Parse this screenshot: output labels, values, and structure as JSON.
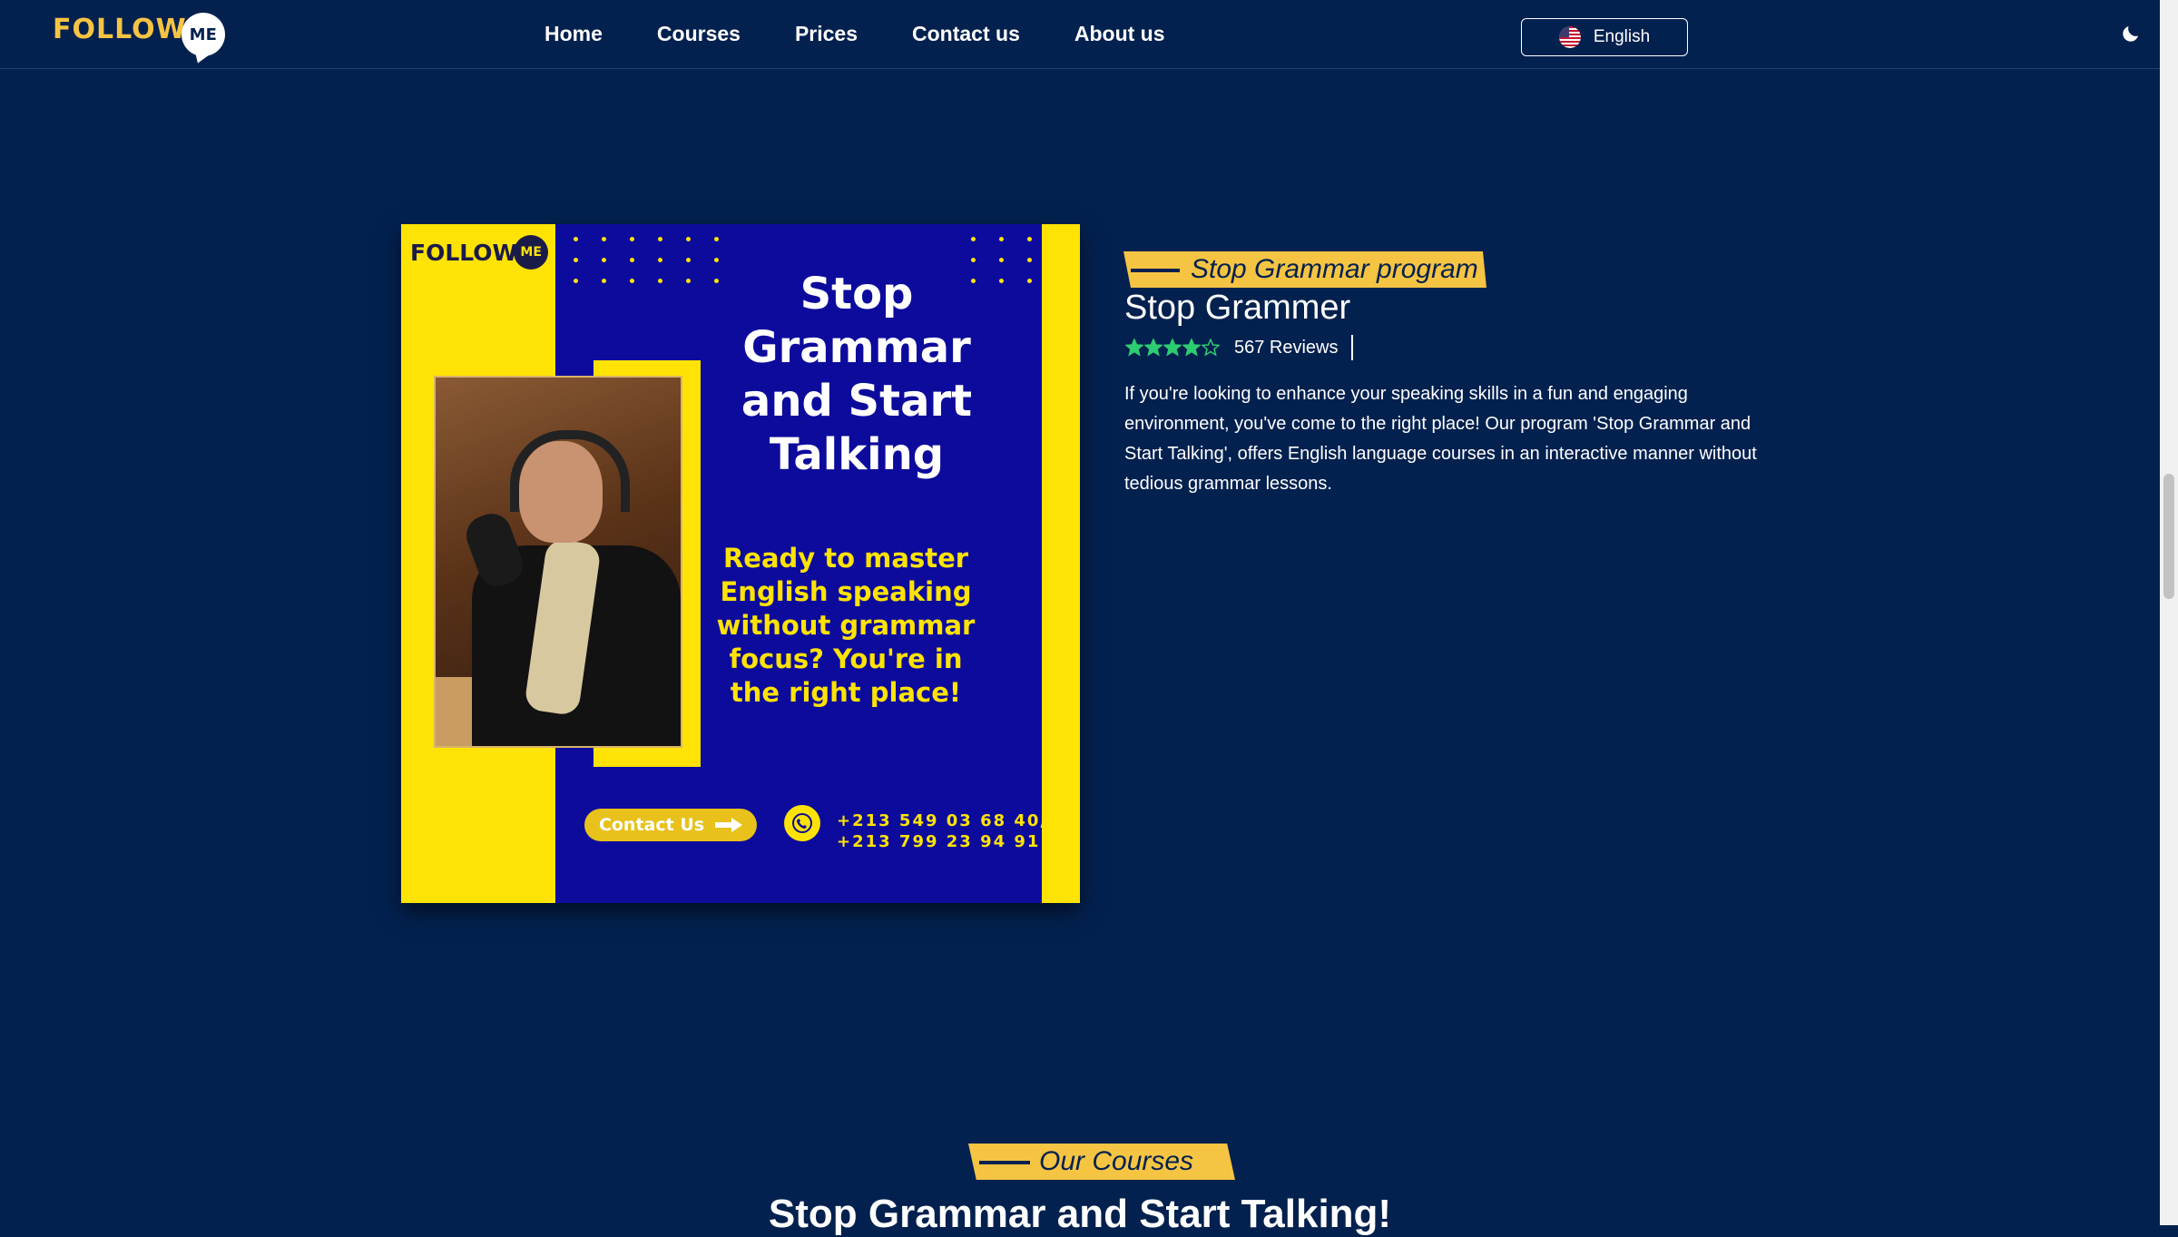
{
  "navbar": {
    "logo": {
      "text": "FOLLOW",
      "bubble": "ME"
    },
    "links": [
      "Home",
      "Courses",
      "Prices",
      "Contact us",
      "About us"
    ],
    "language": "English",
    "theme_icon": "moon-icon"
  },
  "course": {
    "tag": "Stop Grammar program",
    "title": "Stop Grammer",
    "rating": 4,
    "rating_max": 5,
    "reviews": "567 Reviews",
    "description": "If you're looking to enhance your speaking skills in a fun and engaging environment, you've come to the right place! Our program 'Stop Grammar and Start Talking', offers English language courses in an interactive manner without tedious grammar lessons.",
    "poster": {
      "logo_text": "FOLLOW",
      "logo_bubble": "ME",
      "title": "Stop Grammar and Start Talking",
      "subtitle": "Ready to master English speaking without grammar focus? You're in the right place!",
      "contact_button": "Contact Us",
      "phone_1": "+213 549 03 68 40/",
      "phone_2": "+213 799 23 94 91"
    }
  },
  "courses_section": {
    "tag": "Our Courses",
    "heading": "Stop Grammar and Start Talking!"
  },
  "colors": {
    "background": "#03214f",
    "accent": "#f6c443",
    "star": "#2ecc71",
    "poster_blue": "#0d0b9c",
    "poster_yellow": "#ffe304"
  }
}
